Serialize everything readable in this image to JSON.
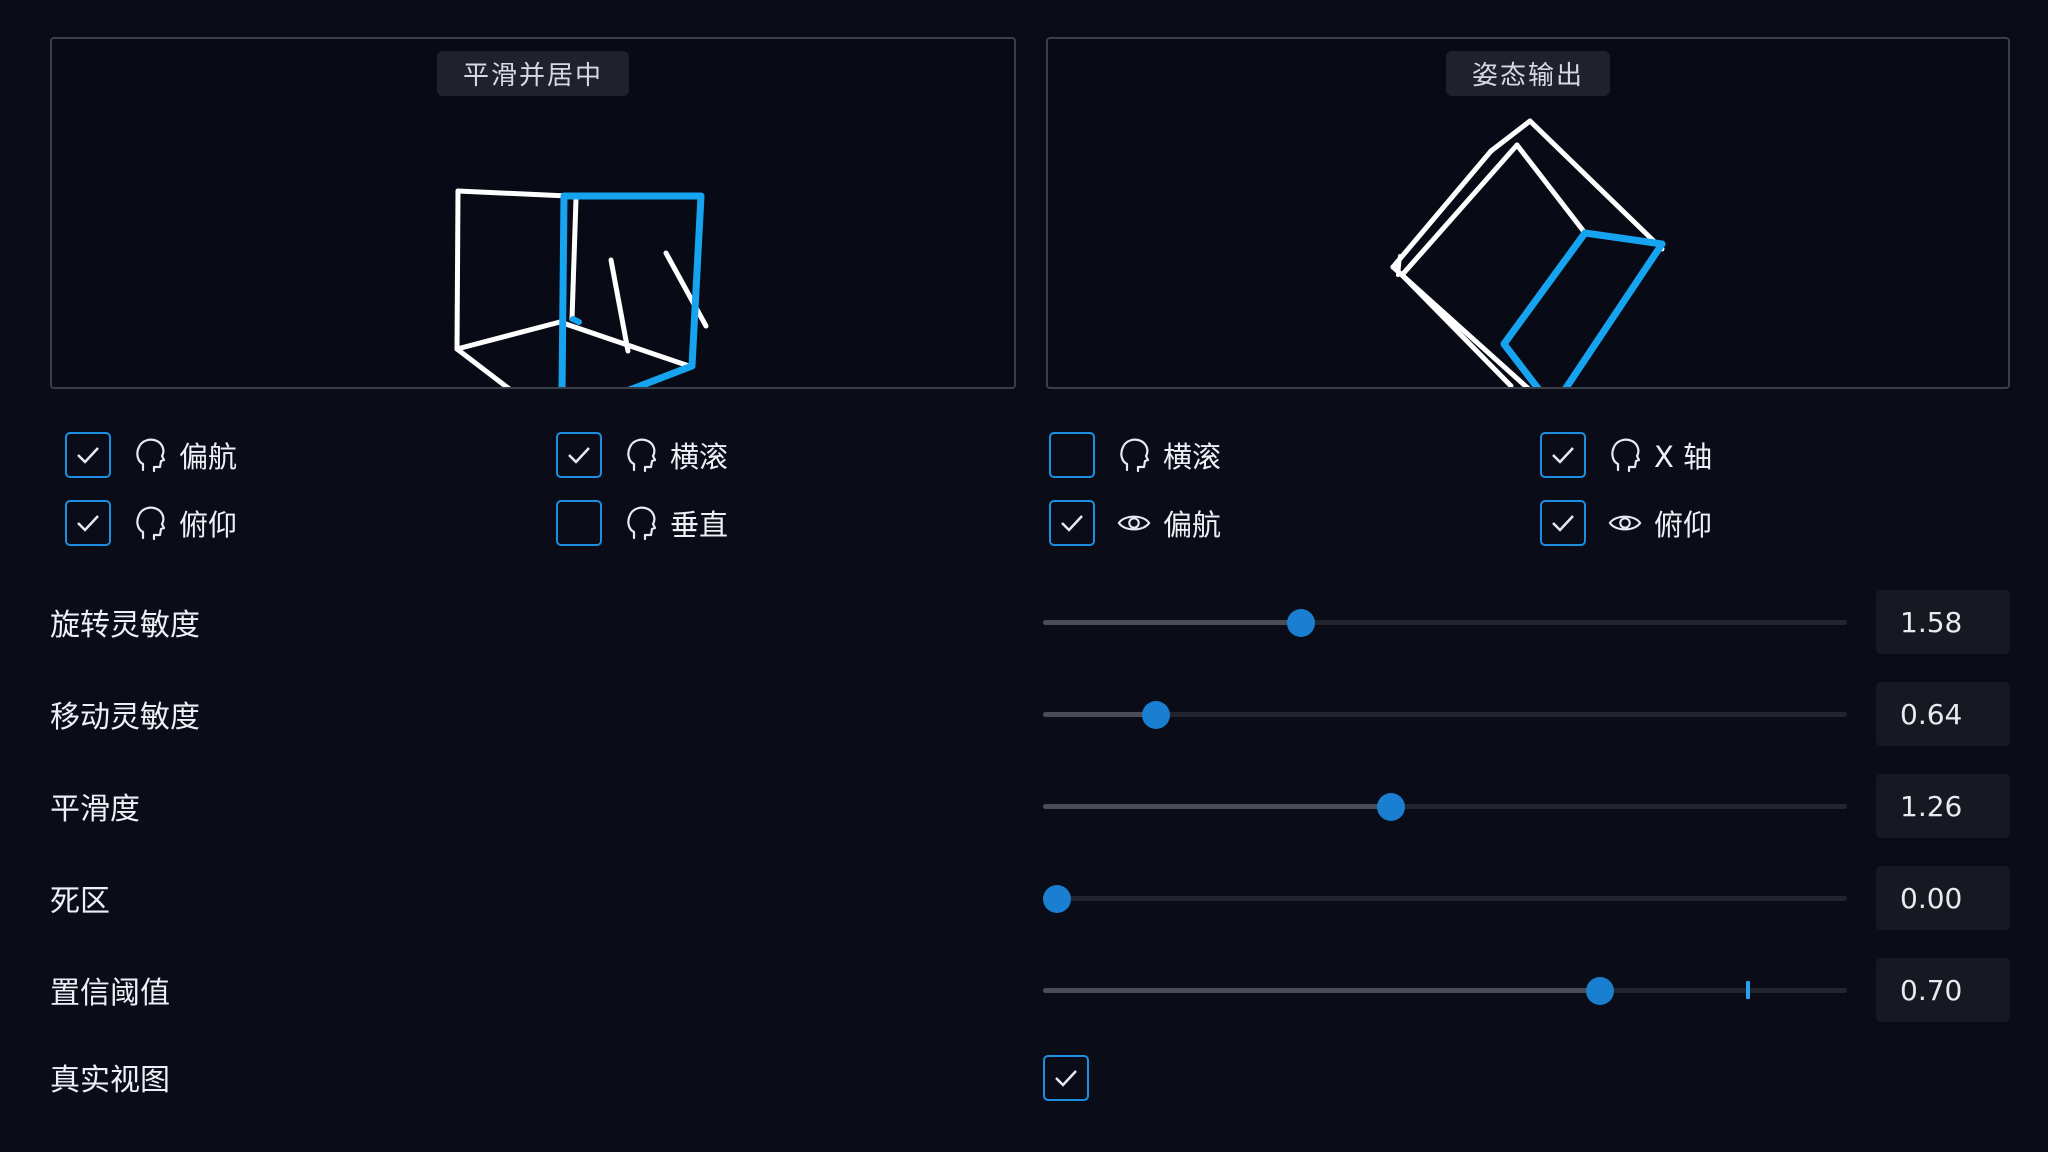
{
  "panels": {
    "left": {
      "title": "平滑并居中"
    },
    "right": {
      "title": "姿态输出"
    }
  },
  "options": [
    {
      "id": "opt-yaw-head",
      "label": "偏航",
      "checked": true,
      "icon": "head-icon"
    },
    {
      "id": "opt-roll-head",
      "label": "横滚",
      "checked": true,
      "icon": "head-icon"
    },
    {
      "id": "opt-pitch-head",
      "label": "俯仰",
      "checked": true,
      "icon": "head-icon"
    },
    {
      "id": "opt-vertical-head",
      "label": "垂直",
      "checked": false,
      "icon": "head-icon"
    },
    {
      "id": "opt-roll-output",
      "label": "横滚",
      "checked": false,
      "icon": "head-icon"
    },
    {
      "id": "opt-x-axis-output",
      "label": "X 轴",
      "checked": true,
      "icon": "head-icon"
    },
    {
      "id": "opt-yaw-eye",
      "label": "偏航",
      "checked": true,
      "icon": "eye-icon"
    },
    {
      "id": "opt-pitch-eye",
      "label": "俯仰",
      "checked": true,
      "icon": "eye-icon"
    }
  ],
  "settings": [
    {
      "id": "rotation-sensitivity",
      "label": "旋转灵敏度",
      "value": "1.58",
      "fraction": 0.315
    },
    {
      "id": "movement-sensitivity",
      "label": "移动灵敏度",
      "value": "0.64",
      "fraction": 0.127
    },
    {
      "id": "smoothness",
      "label": "平滑度",
      "value": "1.26",
      "fraction": 0.43
    },
    {
      "id": "dead-zone",
      "label": "死区",
      "value": "0.00",
      "fraction": 0.0
    },
    {
      "id": "confidence-threshold",
      "label": "置信阈值",
      "value": "0.70",
      "fraction": 0.7,
      "marker_fraction": 0.89
    }
  ],
  "realistic_view": {
    "label": "真实视图",
    "checked": true
  },
  "colors": {
    "accent": "#1d8fe0",
    "cube_highlight": "#16a4f0",
    "cube_line": "#ffffff",
    "background": "#0a0d18"
  }
}
